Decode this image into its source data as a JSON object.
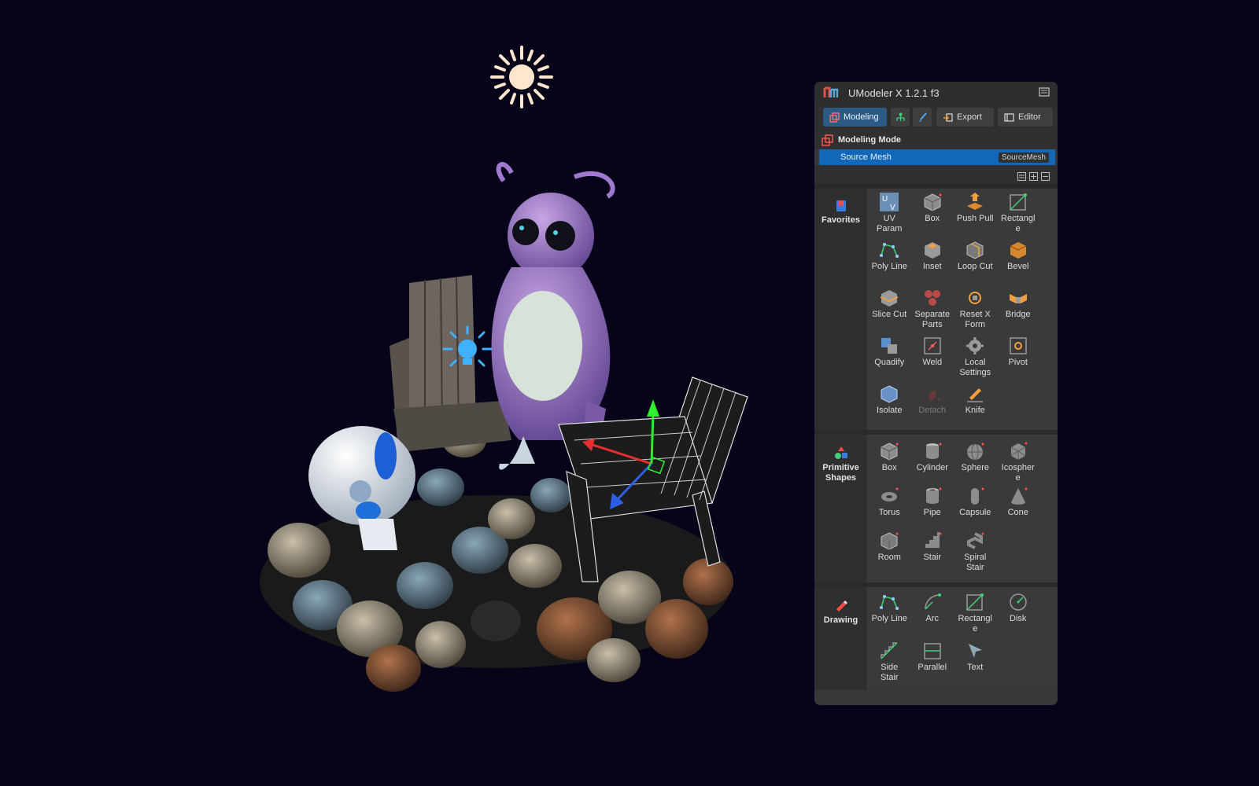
{
  "window": {
    "title": "UModeler X 1.2.1 f3"
  },
  "tabs": [
    {
      "label": "Modeling",
      "active": true
    },
    {
      "label": "",
      "icon": "hierarchy-icon"
    },
    {
      "label": "",
      "icon": "brush-icon"
    },
    {
      "label": "Export",
      "icon": "export-icon"
    },
    {
      "label": "Editor",
      "icon": "editor-icon"
    }
  ],
  "mode": {
    "title": "Modeling Mode"
  },
  "source": {
    "label": "Source Mesh",
    "value": "SourceMesh"
  },
  "sections": [
    {
      "name": "Favorites",
      "icon": "favorites-icon",
      "tools": [
        {
          "label": "UV\nParam",
          "icon": "uv-param-icon"
        },
        {
          "label": "Box",
          "icon": "box-icon"
        },
        {
          "label": "Push Pull",
          "icon": "push-pull-icon"
        },
        {
          "label": "Rectangl\ne",
          "icon": "rectangle-icon"
        },
        {
          "label": "Poly Line",
          "icon": "poly-line-icon"
        },
        {
          "label": "Inset",
          "icon": "inset-icon"
        },
        {
          "label": "Loop Cut",
          "icon": "loop-cut-icon"
        },
        {
          "label": "Bevel",
          "icon": "bevel-icon"
        },
        {
          "label": "Slice Cut",
          "icon": "slice-cut-icon"
        },
        {
          "label": "Separate\nParts",
          "icon": "separate-parts-icon"
        },
        {
          "label": "Reset X\nForm",
          "icon": "reset-xform-icon"
        },
        {
          "label": "Bridge",
          "icon": "bridge-icon"
        },
        {
          "label": "Quadify",
          "icon": "quadify-icon"
        },
        {
          "label": "Weld",
          "icon": "weld-icon"
        },
        {
          "label": "Local\nSettings",
          "icon": "gear-icon"
        },
        {
          "label": "Pivot",
          "icon": "pivot-icon"
        },
        {
          "label": "Isolate",
          "icon": "isolate-icon"
        },
        {
          "label": "Detach",
          "icon": "detach-icon",
          "disabled": true
        },
        {
          "label": "Knife",
          "icon": "knife-icon"
        }
      ]
    },
    {
      "name": "Primitive\nShapes",
      "icon": "primitive-shapes-icon",
      "tools": [
        {
          "label": "Box",
          "icon": "box-icon"
        },
        {
          "label": "Cylinder",
          "icon": "cylinder-icon"
        },
        {
          "label": "Sphere",
          "icon": "sphere-icon"
        },
        {
          "label": "Icospher\ne",
          "icon": "icosphere-icon"
        },
        {
          "label": "Torus",
          "icon": "torus-icon"
        },
        {
          "label": "Pipe",
          "icon": "pipe-icon"
        },
        {
          "label": "Capsule",
          "icon": "capsule-icon"
        },
        {
          "label": "Cone",
          "icon": "cone-icon"
        },
        {
          "label": "Room",
          "icon": "room-icon"
        },
        {
          "label": "Stair",
          "icon": "stair-icon"
        },
        {
          "label": "Spiral\nStair",
          "icon": "spiral-stair-icon"
        }
      ]
    },
    {
      "name": "Drawing",
      "icon": "drawing-icon",
      "tools": [
        {
          "label": "Poly Line",
          "icon": "poly-line-icon"
        },
        {
          "label": "Arc",
          "icon": "arc-icon"
        },
        {
          "label": "Rectangl\ne",
          "icon": "rectangle-icon"
        },
        {
          "label": "Disk",
          "icon": "disk-icon"
        },
        {
          "label": "Side\nStair",
          "icon": "side-stair-icon"
        },
        {
          "label": "Parallel",
          "icon": "parallel-icon"
        },
        {
          "label": "Text",
          "icon": "text-tool-icon"
        }
      ]
    }
  ],
  "colors": {
    "accent": "#1168b8",
    "tab_active": "#2b5a85",
    "panel": "#383838",
    "viewport_bg": "#07041a"
  }
}
